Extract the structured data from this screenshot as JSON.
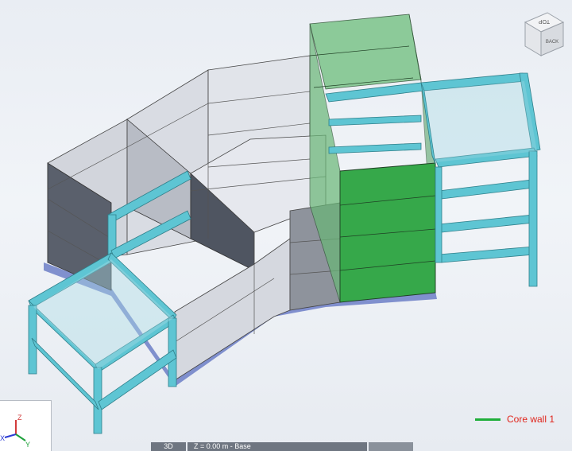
{
  "viewcube": {
    "face_top": "TOP",
    "face_back": "BACK"
  },
  "triad": {
    "z_label": "Z",
    "x_label": "X",
    "y_label": "Y"
  },
  "legend": {
    "label": "Core wall 1",
    "color": "#1fae3a"
  },
  "statusbar": {
    "view_mode": "3D",
    "level": "Z = 0.00 m - Base"
  },
  "colors": {
    "background": "#eef1f5",
    "wall_light": "#d7dae1",
    "wall_mid": "#b9bdc6",
    "wall_dark": "#5f6572",
    "core_wall": "#35a64a",
    "frame": "#58c2d0",
    "slab": "#8fd0e0"
  }
}
